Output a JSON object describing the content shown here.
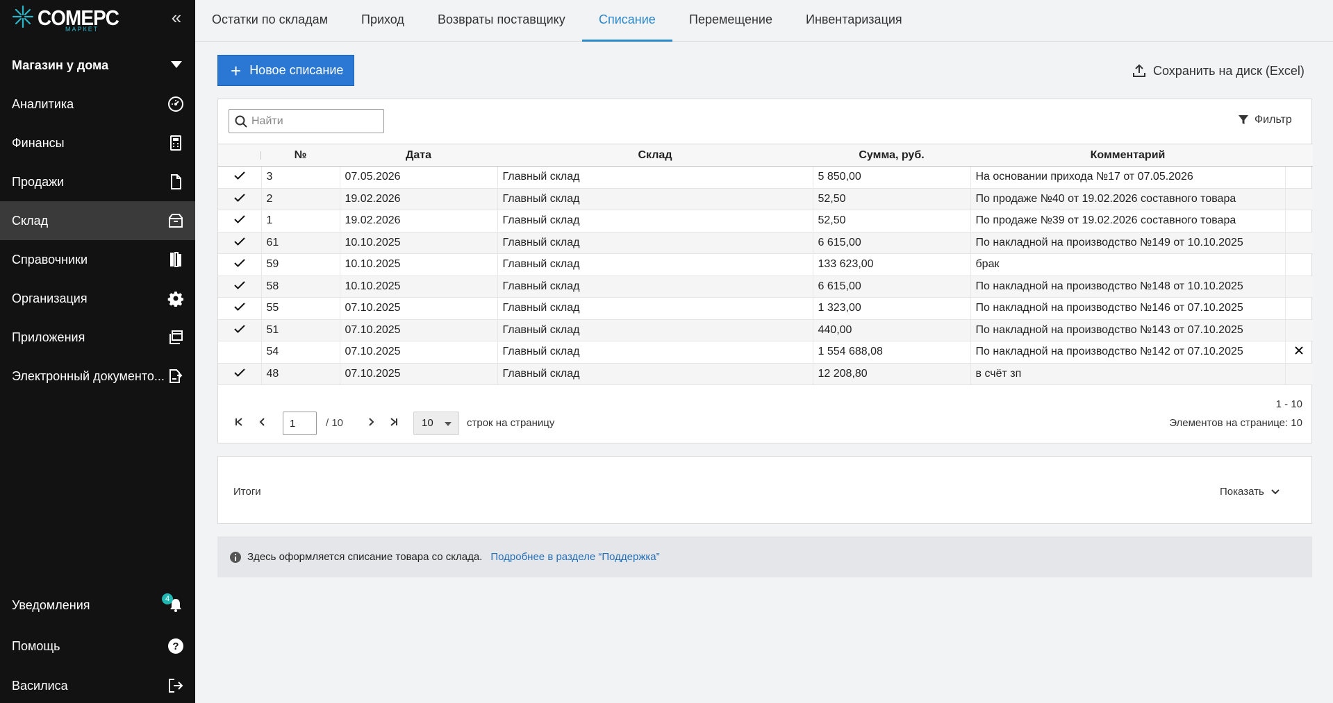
{
  "brand": {
    "name": "COMEPC",
    "sub": "МАРКЕТ",
    "accent": "#29b6c8"
  },
  "sidebar": {
    "shop": "Магазин у дома",
    "items": [
      {
        "label": "Аналитика",
        "icon": "speedometer-icon"
      },
      {
        "label": "Финансы",
        "icon": "calculator-icon"
      },
      {
        "label": "Продажи",
        "icon": "document-icon"
      },
      {
        "label": "Склад",
        "icon": "warehouse-box-icon",
        "active": true
      },
      {
        "label": "Справочники",
        "icon": "books-icon"
      },
      {
        "label": "Организация",
        "icon": "gear-icon"
      },
      {
        "label": "Приложения",
        "icon": "windows-icon"
      },
      {
        "label": "Электронный документо...",
        "icon": "edo-document-icon"
      }
    ],
    "bottom": [
      {
        "label": "Уведомления",
        "icon": "bell-icon",
        "badge": "4"
      },
      {
        "label": "Помощь",
        "icon": "help-icon"
      },
      {
        "label": "Василиса",
        "icon": "logout-icon"
      }
    ]
  },
  "tabs": [
    "Остатки по складам",
    "Приход",
    "Возвраты поставщику",
    "Списание",
    "Перемещение",
    "Инвентаризация"
  ],
  "active_tab": "Списание",
  "toolbar": {
    "new_label": "Новое списание",
    "excel_label": "Сохранить на диск (Excel)"
  },
  "grid": {
    "search_placeholder": "Найти",
    "filter_label": "Фильтр",
    "columns": [
      "№",
      "Дата",
      "Склад",
      "Сумма, руб.",
      "Комментарий"
    ],
    "rows": [
      {
        "checked": true,
        "num": "3",
        "date": "07.05.2026",
        "store": "Главный склад",
        "sum": "5 850,00",
        "comment": "На основании прихода №17 от 07.05.2026"
      },
      {
        "checked": true,
        "num": "2",
        "date": "19.02.2026",
        "store": "Главный склад",
        "sum": "52,50",
        "comment": "По продаже №40 от 19.02.2026 составного товара"
      },
      {
        "checked": true,
        "num": "1",
        "date": "19.02.2026",
        "store": "Главный склад",
        "sum": "52,50",
        "comment": "По продаже №39 от 19.02.2026 составного товара"
      },
      {
        "checked": true,
        "num": "61",
        "date": "10.10.2025",
        "store": "Главный склад",
        "sum": "6 615,00",
        "comment": "По накладной на производство №149 от 10.10.2025"
      },
      {
        "checked": true,
        "num": "59",
        "date": "10.10.2025",
        "store": "Главный склад",
        "sum": "133 623,00",
        "comment": "брак"
      },
      {
        "checked": true,
        "num": "58",
        "date": "10.10.2025",
        "store": "Главный склад",
        "sum": "6 615,00",
        "comment": "По накладной на производство №148 от 10.10.2025"
      },
      {
        "checked": true,
        "num": "55",
        "date": "07.10.2025",
        "store": "Главный склад",
        "sum": "1 323,00",
        "comment": "По накладной на производство №146 от 07.10.2025"
      },
      {
        "checked": true,
        "num": "51",
        "date": "07.10.2025",
        "store": "Главный склад",
        "sum": "440,00",
        "comment": "По накладной на производство №143 от 07.10.2025"
      },
      {
        "checked": false,
        "num": "54",
        "date": "07.10.2025",
        "store": "Главный склад",
        "sum": "1 554 688,08",
        "comment": "По накладной на производство №142 от 07.10.2025",
        "deletable": true
      },
      {
        "checked": true,
        "num": "48",
        "date": "07.10.2025",
        "store": "Главный склад",
        "sum": "12 208,80",
        "comment": "в счёт зп"
      }
    ]
  },
  "pager": {
    "page": "1",
    "of": "/ 10",
    "page_size": "10",
    "page_size_label": "строк на страницу",
    "range": "1 - 10",
    "per_page_info": "Элементов на странице: 10"
  },
  "totals": {
    "label": "Итоги",
    "show_label": "Показать"
  },
  "info": {
    "text": "Здесь оформляется списание товара со склада.",
    "link": "Подробнее в разделе “Поддержка”"
  }
}
